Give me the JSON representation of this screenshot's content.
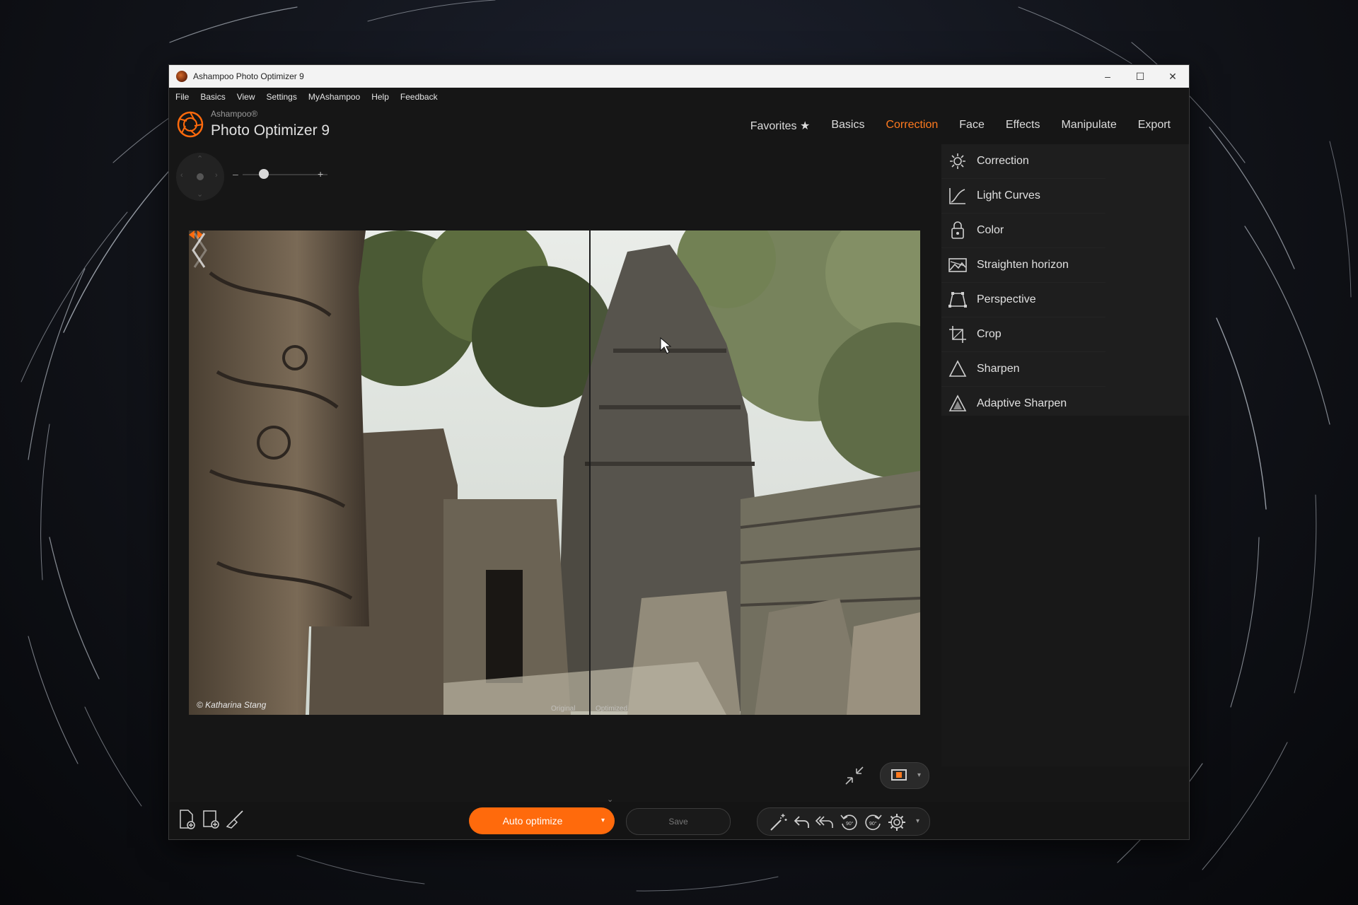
{
  "window": {
    "title": "Ashampoo Photo Optimizer 9",
    "minimize": "–",
    "maximize": "☐",
    "close": "✕"
  },
  "menu": [
    "File",
    "Basics",
    "View",
    "Settings",
    "MyAshampoo",
    "Help",
    "Feedback"
  ],
  "brand": {
    "small": "Ashampoo®",
    "big": "Photo Optimizer 9"
  },
  "nav": {
    "tabs": [
      "Favorites ★",
      "Basics",
      "Correction",
      "Face",
      "Effects",
      "Manipulate",
      "Export"
    ],
    "active": "Correction"
  },
  "zoom": {
    "minus": "–",
    "plus": "+",
    "level": 0.25
  },
  "photo": {
    "credit": "© Katharina Stang",
    "label_original": "Original",
    "label_optimized": "Optimized"
  },
  "sidebar": {
    "items": [
      {
        "label": "Correction",
        "icon": "sun-icon"
      },
      {
        "label": "Light Curves",
        "icon": "curve-icon"
      },
      {
        "label": "Color",
        "icon": "palette-icon"
      },
      {
        "label": "Straighten horizon",
        "icon": "horizon-icon"
      },
      {
        "label": "Perspective",
        "icon": "perspective-icon"
      },
      {
        "label": "Crop",
        "icon": "crop-icon"
      },
      {
        "label": "Sharpen",
        "icon": "triangle-icon"
      },
      {
        "label": "Adaptive Sharpen",
        "icon": "triangle-filled-icon"
      }
    ]
  },
  "bottom": {
    "auto_optimize": "Auto optimize",
    "save": "Save",
    "rotate_left": "90°",
    "rotate_right": "90°",
    "dropdown": "▾"
  },
  "colors": {
    "accent": "#ff6a0c",
    "active_tab": "#ff7a1f",
    "panel": "#1e1e1e",
    "window": "#161616"
  }
}
